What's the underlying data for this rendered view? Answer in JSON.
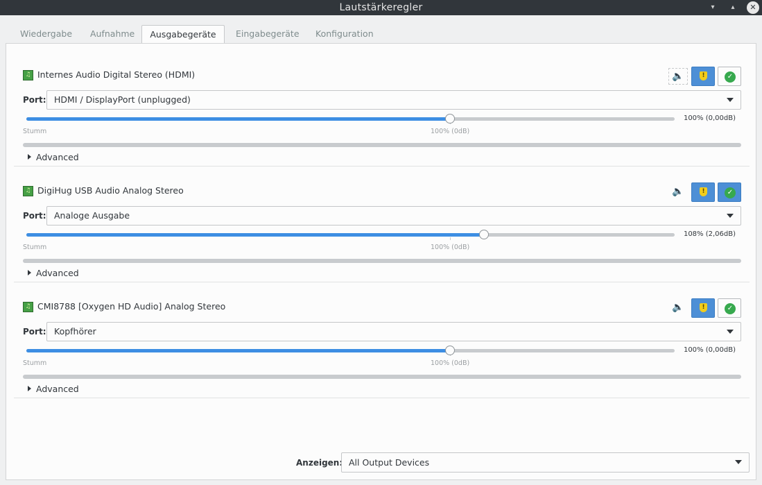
{
  "window": {
    "title": "Lautstärkeregler"
  },
  "tabs": [
    {
      "label": "Wiedergabe",
      "active": false
    },
    {
      "label": "Aufnahme",
      "active": false
    },
    {
      "label": "Ausgabegeräte",
      "active": true
    },
    {
      "label": "Eingabegeräte",
      "active": false
    },
    {
      "label": "Konfiguration",
      "active": false
    }
  ],
  "port_label": "Port:",
  "scale": {
    "mute_label": "Stumm",
    "zero_label": "100% (0dB)",
    "max_percent": 153
  },
  "advanced_label": "Advanced",
  "devices": [
    {
      "name": "Internes Audio Digital Stereo (HDMI)",
      "port": "HDMI / DisplayPort (unplugged)",
      "volume_percent": 100,
      "volume_text": "100% (0,00dB)",
      "locked": true,
      "is_default": false
    },
    {
      "name": "DigiHug USB Audio Analog Stereo",
      "port": "Analoge Ausgabe",
      "volume_percent": 108,
      "volume_text": "108% (2,06dB)",
      "locked": true,
      "is_default": true
    },
    {
      "name": "CMI8788 [Oxygen HD Audio] Analog Stereo",
      "port": "Kopfhörer",
      "volume_percent": 100,
      "volume_text": "100% (0,00dB)",
      "locked": true,
      "is_default": false
    }
  ],
  "footer": {
    "show_label": "Anzeigen:",
    "show_value": "All Output Devices"
  },
  "colors": {
    "accent": "#3d8ee3",
    "titlebar": "#31363b",
    "check": "#37a94e",
    "lock": "#f2cd1c"
  },
  "icons": {
    "device": "sound-card-icon",
    "mute": "speaker-icon",
    "lock": "shield-lock-icon",
    "default": "check-icon"
  }
}
